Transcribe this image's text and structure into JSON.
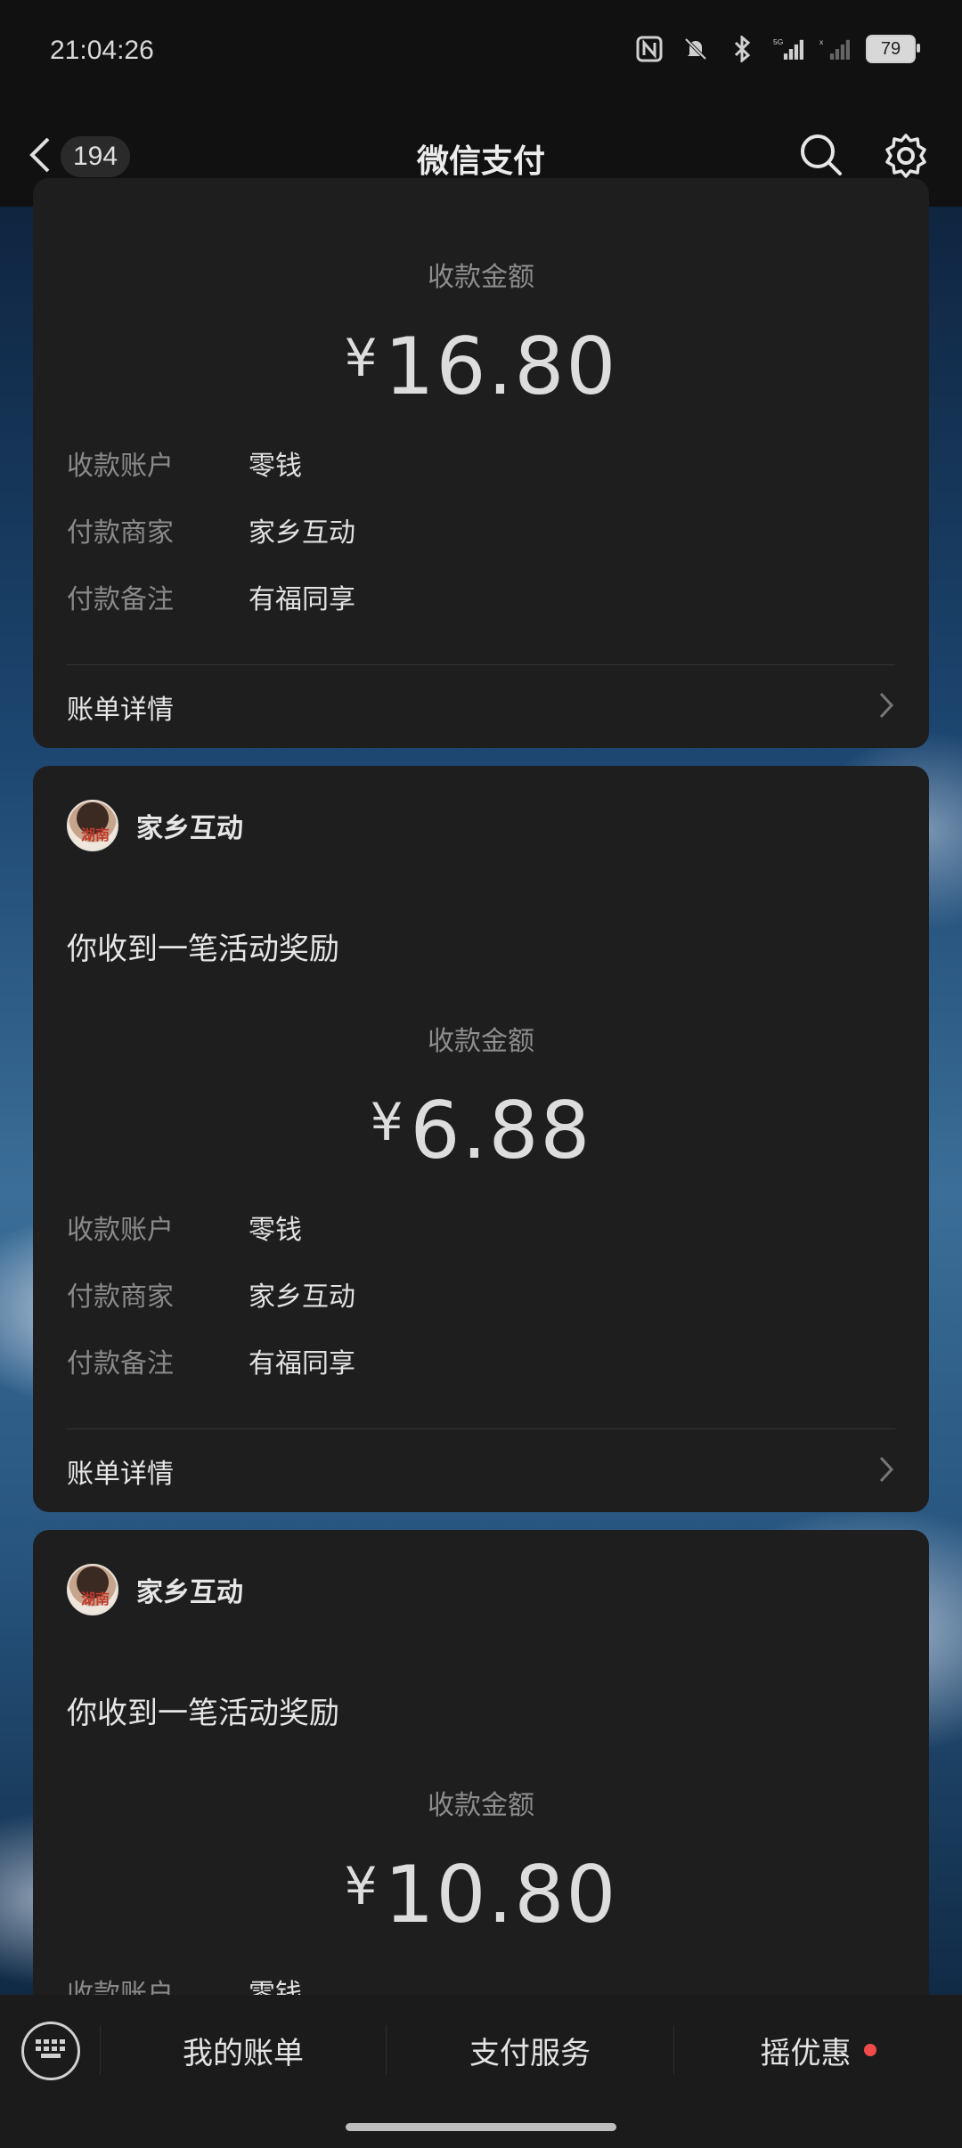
{
  "status_bar": {
    "time": "21:04:26",
    "battery": "79"
  },
  "nav": {
    "back_count": "194",
    "title": "微信支付"
  },
  "cards": [
    {
      "amount_label": "收款金额",
      "currency": "¥",
      "amount": "16.80",
      "rows": [
        {
          "key": "收款账户",
          "value": "零钱"
        },
        {
          "key": "付款商家",
          "value": "家乡互动"
        },
        {
          "key": "付款备注",
          "value": "有福同享"
        }
      ],
      "detail_label": "账单详情"
    },
    {
      "merchant": "家乡互动",
      "avatar_text": "湖南",
      "heading": "你收到一笔活动奖励",
      "amount_label": "收款金额",
      "currency": "¥",
      "amount": "6.88",
      "rows": [
        {
          "key": "收款账户",
          "value": "零钱"
        },
        {
          "key": "付款商家",
          "value": "家乡互动"
        },
        {
          "key": "付款备注",
          "value": "有福同享"
        }
      ],
      "detail_label": "账单详情"
    },
    {
      "merchant": "家乡互动",
      "avatar_text": "湖南",
      "heading": "你收到一笔活动奖励",
      "amount_label": "收款金额",
      "currency": "¥",
      "amount": "10.80",
      "rows": [
        {
          "key": "收款账户",
          "value": "零钱"
        }
      ]
    }
  ],
  "bottom_bar": {
    "tabs": [
      "我的账单",
      "支付服务",
      "摇优惠"
    ],
    "badge_color": "#f04a4a"
  }
}
